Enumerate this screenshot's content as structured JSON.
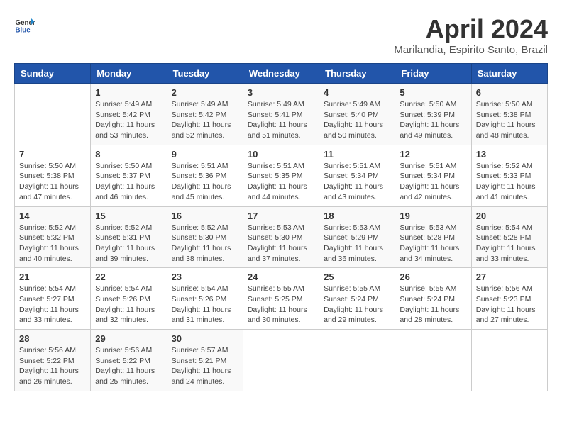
{
  "header": {
    "logo_line1": "General",
    "logo_line2": "Blue",
    "title": "April 2024",
    "location": "Marilandia, Espirito Santo, Brazil"
  },
  "weekdays": [
    "Sunday",
    "Monday",
    "Tuesday",
    "Wednesday",
    "Thursday",
    "Friday",
    "Saturday"
  ],
  "weeks": [
    [
      {
        "day": "",
        "info": ""
      },
      {
        "day": "1",
        "info": "Sunrise: 5:49 AM\nSunset: 5:42 PM\nDaylight: 11 hours\nand 53 minutes."
      },
      {
        "day": "2",
        "info": "Sunrise: 5:49 AM\nSunset: 5:42 PM\nDaylight: 11 hours\nand 52 minutes."
      },
      {
        "day": "3",
        "info": "Sunrise: 5:49 AM\nSunset: 5:41 PM\nDaylight: 11 hours\nand 51 minutes."
      },
      {
        "day": "4",
        "info": "Sunrise: 5:49 AM\nSunset: 5:40 PM\nDaylight: 11 hours\nand 50 minutes."
      },
      {
        "day": "5",
        "info": "Sunrise: 5:50 AM\nSunset: 5:39 PM\nDaylight: 11 hours\nand 49 minutes."
      },
      {
        "day": "6",
        "info": "Sunrise: 5:50 AM\nSunset: 5:38 PM\nDaylight: 11 hours\nand 48 minutes."
      }
    ],
    [
      {
        "day": "7",
        "info": "Sunrise: 5:50 AM\nSunset: 5:38 PM\nDaylight: 11 hours\nand 47 minutes."
      },
      {
        "day": "8",
        "info": "Sunrise: 5:50 AM\nSunset: 5:37 PM\nDaylight: 11 hours\nand 46 minutes."
      },
      {
        "day": "9",
        "info": "Sunrise: 5:51 AM\nSunset: 5:36 PM\nDaylight: 11 hours\nand 45 minutes."
      },
      {
        "day": "10",
        "info": "Sunrise: 5:51 AM\nSunset: 5:35 PM\nDaylight: 11 hours\nand 44 minutes."
      },
      {
        "day": "11",
        "info": "Sunrise: 5:51 AM\nSunset: 5:34 PM\nDaylight: 11 hours\nand 43 minutes."
      },
      {
        "day": "12",
        "info": "Sunrise: 5:51 AM\nSunset: 5:34 PM\nDaylight: 11 hours\nand 42 minutes."
      },
      {
        "day": "13",
        "info": "Sunrise: 5:52 AM\nSunset: 5:33 PM\nDaylight: 11 hours\nand 41 minutes."
      }
    ],
    [
      {
        "day": "14",
        "info": "Sunrise: 5:52 AM\nSunset: 5:32 PM\nDaylight: 11 hours\nand 40 minutes."
      },
      {
        "day": "15",
        "info": "Sunrise: 5:52 AM\nSunset: 5:31 PM\nDaylight: 11 hours\nand 39 minutes."
      },
      {
        "day": "16",
        "info": "Sunrise: 5:52 AM\nSunset: 5:30 PM\nDaylight: 11 hours\nand 38 minutes."
      },
      {
        "day": "17",
        "info": "Sunrise: 5:53 AM\nSunset: 5:30 PM\nDaylight: 11 hours\nand 37 minutes."
      },
      {
        "day": "18",
        "info": "Sunrise: 5:53 AM\nSunset: 5:29 PM\nDaylight: 11 hours\nand 36 minutes."
      },
      {
        "day": "19",
        "info": "Sunrise: 5:53 AM\nSunset: 5:28 PM\nDaylight: 11 hours\nand 34 minutes."
      },
      {
        "day": "20",
        "info": "Sunrise: 5:54 AM\nSunset: 5:28 PM\nDaylight: 11 hours\nand 33 minutes."
      }
    ],
    [
      {
        "day": "21",
        "info": "Sunrise: 5:54 AM\nSunset: 5:27 PM\nDaylight: 11 hours\nand 33 minutes."
      },
      {
        "day": "22",
        "info": "Sunrise: 5:54 AM\nSunset: 5:26 PM\nDaylight: 11 hours\nand 32 minutes."
      },
      {
        "day": "23",
        "info": "Sunrise: 5:54 AM\nSunset: 5:26 PM\nDaylight: 11 hours\nand 31 minutes."
      },
      {
        "day": "24",
        "info": "Sunrise: 5:55 AM\nSunset: 5:25 PM\nDaylight: 11 hours\nand 30 minutes."
      },
      {
        "day": "25",
        "info": "Sunrise: 5:55 AM\nSunset: 5:24 PM\nDaylight: 11 hours\nand 29 minutes."
      },
      {
        "day": "26",
        "info": "Sunrise: 5:55 AM\nSunset: 5:24 PM\nDaylight: 11 hours\nand 28 minutes."
      },
      {
        "day": "27",
        "info": "Sunrise: 5:56 AM\nSunset: 5:23 PM\nDaylight: 11 hours\nand 27 minutes."
      }
    ],
    [
      {
        "day": "28",
        "info": "Sunrise: 5:56 AM\nSunset: 5:22 PM\nDaylight: 11 hours\nand 26 minutes."
      },
      {
        "day": "29",
        "info": "Sunrise: 5:56 AM\nSunset: 5:22 PM\nDaylight: 11 hours\nand 25 minutes."
      },
      {
        "day": "30",
        "info": "Sunrise: 5:57 AM\nSunset: 5:21 PM\nDaylight: 11 hours\nand 24 minutes."
      },
      {
        "day": "",
        "info": ""
      },
      {
        "day": "",
        "info": ""
      },
      {
        "day": "",
        "info": ""
      },
      {
        "day": "",
        "info": ""
      }
    ]
  ]
}
